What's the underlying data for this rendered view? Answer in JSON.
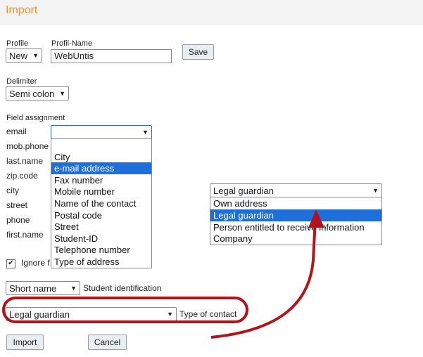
{
  "window": {
    "title": "Import"
  },
  "profile": {
    "label": "Profile",
    "value": "New"
  },
  "profile_name": {
    "label": "Profil-Name",
    "value": "WebUntis"
  },
  "save_label": "Save",
  "delimiter": {
    "label": "Delimiter",
    "value": "Semi colon"
  },
  "field_assignment": {
    "label": "Field assignment",
    "fields": [
      "email",
      "mob.phone",
      "last.name",
      "zip.code",
      "city",
      "street",
      "phone",
      "first.name"
    ],
    "email_select_value": "",
    "dropdown_options": [
      "City",
      "e-mail address",
      "Fax number",
      "Mobile number",
      "Name of the contact",
      "Postal code",
      "Street",
      "Student-ID",
      "Telephone number",
      "Type of address"
    ],
    "dropdown_selected": "e-mail address"
  },
  "contact_type_select": {
    "value": "Legal guardian",
    "options": [
      "Own address",
      "Legal guardian",
      "Person entitled to receive information",
      "Company"
    ],
    "selected": "Legal guardian"
  },
  "ignore_checkbox": {
    "label": "Ignore f",
    "checked": true
  },
  "student_identification": {
    "value": "Short name",
    "label": "Student identification"
  },
  "type_of_contact": {
    "value": "Legal guardian",
    "label": "Type of contact"
  },
  "import_label": "Import",
  "cancel_label": "Cancel",
  "colors": {
    "title": "#f0922b",
    "highlight": "#1e6fd9",
    "annotation": "#b3141c"
  }
}
